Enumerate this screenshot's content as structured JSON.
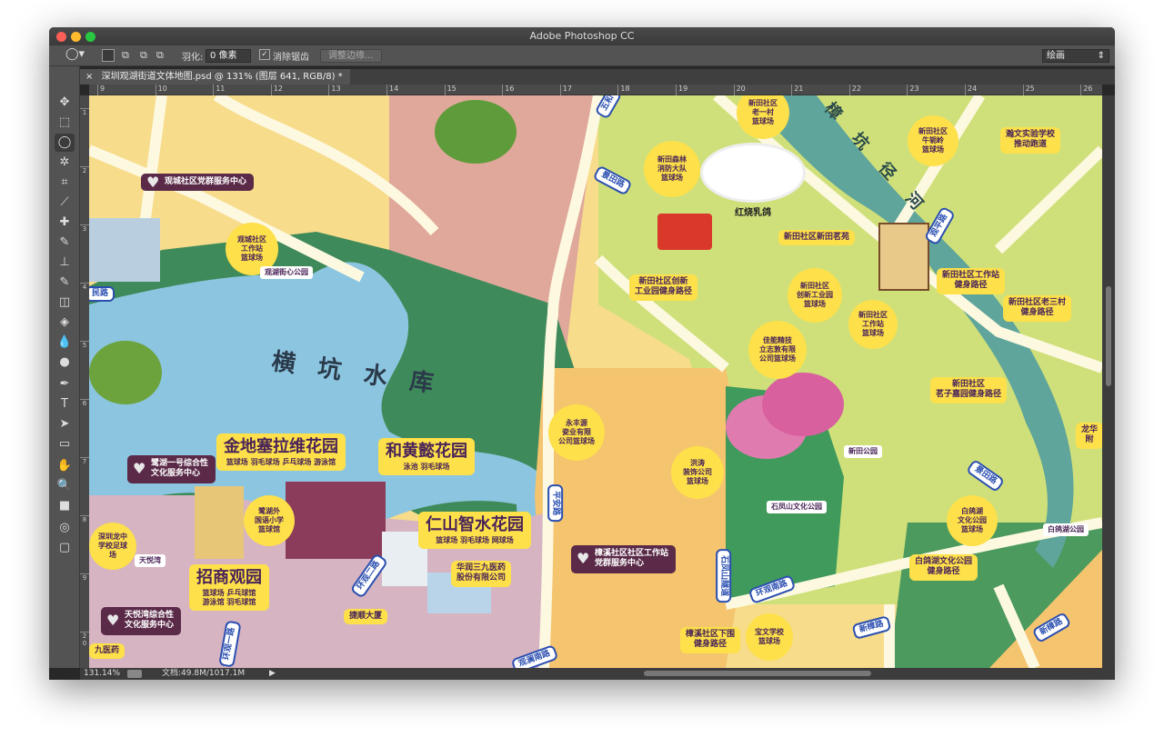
{
  "window": {
    "title": "Adobe Photoshop CC"
  },
  "options_bar": {
    "tool_icon": "lasso-icon",
    "feather_label": "羽化:",
    "feather_value": "0 像素",
    "antialias_label": "消除锯齿",
    "antialias_checked": true,
    "refine_edge": "调整边缘...",
    "workspace": "绘画"
  },
  "document_tab": {
    "close": "×",
    "title": "深圳观湖街道文体地图.psd @ 131% (图层 641, RGB/8) *"
  },
  "ruler_top": [
    "9",
    "10",
    "11",
    "12",
    "13",
    "14",
    "15",
    "16",
    "17",
    "18",
    "19",
    "20",
    "21",
    "22",
    "23",
    "24",
    "25",
    "26"
  ],
  "ruler_left": [
    "1",
    "2",
    "3",
    "4",
    "5",
    "6",
    "7",
    "8",
    "9",
    "2 0"
  ],
  "tools": [
    "move-icon",
    "marquee-icon",
    "lasso-icon",
    "magic-wand-icon",
    "crop-icon",
    "eyedropper-icon",
    "healing-brush-icon",
    "brush-icon",
    "clone-stamp-icon",
    "history-brush-icon",
    "eraser-icon",
    "paint-bucket-icon",
    "blur-icon",
    "dodge-icon",
    "pen-icon",
    "type-icon",
    "path-selection-icon",
    "rectangle-icon",
    "hand-icon",
    "zoom-icon",
    "color-swatches-icon",
    "quick-mask-icon",
    "screen-mode-icon"
  ],
  "tool_glyphs": [
    "✥",
    "⬚",
    "◯",
    "✲",
    "⌗",
    "⟋",
    "✚",
    "✎",
    "⊥",
    "✎",
    "◫",
    "◈",
    "💧",
    "●",
    "✒",
    "T",
    "➤",
    "▭",
    "✋",
    "🔍",
    "■",
    "◎",
    "▢"
  ],
  "status": {
    "zoom": "131.14%",
    "doc": "文档:49.8M/1017.1M",
    "arrow": "▶"
  },
  "map": {
    "lake": "横 坑 水 库",
    "river": "樟 坑 径 河",
    "dish": "红烧乳鸽",
    "yellow": [
      "观城社区\n工作站\n篮球场",
      "新田森林\n消防大队\n篮球场",
      "新田社区\n老一村\n篮球场",
      "新田社区\n牛轭岭\n篮球场",
      "瀚文实验学校\n推动跑道",
      "新田社区新田茗苑",
      "新田社区创新\n工业园健身路径",
      "新田社区\n创新工业园\n篮球场",
      "新田社区工作站\n健身路径",
      "新田社区老三村\n健身路径",
      "新田社区\n工作站\n篮球场",
      "佳能精技\n立志敦有限\n公司篮球场",
      "新田社区\n茗子嘉园健身路径",
      "永丰源\n瓷业有限\n公司篮球场",
      "洪涛\n装饰公司\n篮球场",
      "鹭湖外\n国语小学\n篮球馆",
      "华润三九医药\n股份有限公司",
      "捷顺大厦",
      "白鸽湖\n文化公园\n篮球场",
      "白鸽湖文化公园\n健身路径",
      "宝文学校\n篮球场",
      "樟溪社区下围\n健身路径",
      "九医药",
      "深圳龙中\n学校足球\n场",
      "龙华\n附"
    ],
    "estates": [
      {
        "name": "金地塞拉维花园",
        "facilities": "篮球场 羽毛球场 乒乓球场 游泳馆"
      },
      {
        "name": "和黄懿花园",
        "facilities": "泳池 羽毛球场"
      },
      {
        "name": "仁山智水花园",
        "facilities": "篮球场 羽毛球场 网球场"
      },
      {
        "name": "招商观园",
        "facilities": "篮球场 乒乓球馆\n游泳馆 羽毛球馆"
      }
    ],
    "purple": [
      "观城社区党群服务中心",
      "鹭湖一号综合性\n文化服务中心",
      "天悦湾综合性\n文化服务中心",
      "樟溪社区社区工作站\n党群服务中心"
    ],
    "signs": [
      "观湖街心公园",
      "新田公园",
      "石凤山文化公园",
      "白鸽湖公园",
      "天悦湾"
    ],
    "roads": [
      "景田路",
      "观平路",
      "平安路",
      "石凤山隧道",
      "环观南路",
      "新樟路",
      "新樟路",
      "景田路",
      "观澜南路",
      "环观二路",
      "环观一路",
      "民路",
      "五和"
    ]
  },
  "colors": {
    "party_purple": "#5a2a48",
    "label_yellow": "#fde04a",
    "road_blue": "#2b4fb0"
  }
}
